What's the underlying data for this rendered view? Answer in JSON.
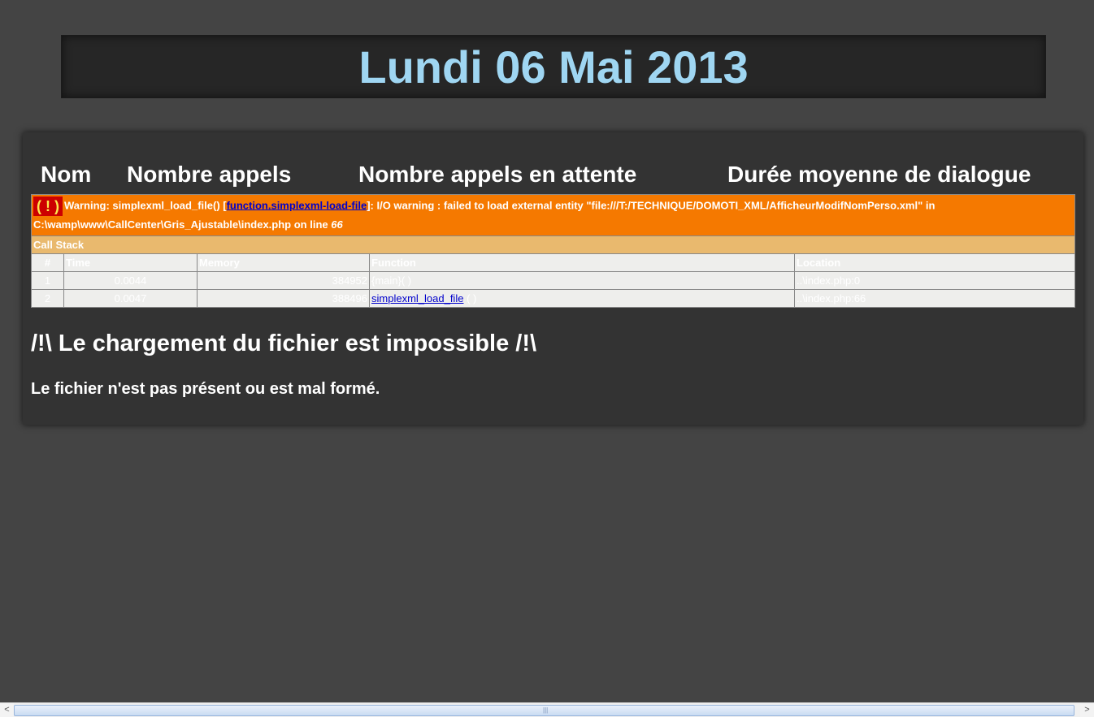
{
  "header": {
    "date": "Lundi 06 Mai 2013"
  },
  "columns": {
    "nom": "Nom",
    "appels": "Nombre appels",
    "attente": "Nombre appels en attente",
    "duree": "Durée moyenne de dialogue"
  },
  "warning": {
    "icon": "( ! )",
    "prefix": "Warning: simplexml_load_file() [",
    "link": "function.simplexml-load-file",
    "suffix": "]: I/O warning : failed to load external entity \"file:///T:/TECHNIQUE/DOMOTI_XML/AfficheurModifNomPerso.xml\" in C:\\wamp\\www\\CallCenter\\Gris_Ajustable\\index.php on line ",
    "line": "66"
  },
  "call_stack": {
    "title": "Call Stack",
    "headers": [
      "#",
      "Time",
      "Memory",
      "Function",
      "Location"
    ],
    "rows": [
      {
        "num": "1",
        "time": "0.0044",
        "memory": "384952",
        "function": "{main}( )",
        "function_paren": "",
        "location": "..\\index.php:0"
      },
      {
        "num": "2",
        "time": "0.0047",
        "memory": "388496",
        "function": "simplexml_load_file",
        "function_paren": " ( )",
        "location": "..\\index.php:66"
      }
    ]
  },
  "error": {
    "title": "/!\\ Le chargement du fichier est impossible /!\\",
    "message": "Le fichier n'est pas présent ou est mal formé."
  },
  "scrollbar": {
    "left_arrow": "<",
    "right_arrow": ">",
    "grip": "|||"
  },
  "colors": {
    "background": "#444444",
    "date_text": "#9fd6f2",
    "warning_bg": "#f57900",
    "callstack_bg": "#e9b96e",
    "table_bg": "#eeeeec"
  }
}
